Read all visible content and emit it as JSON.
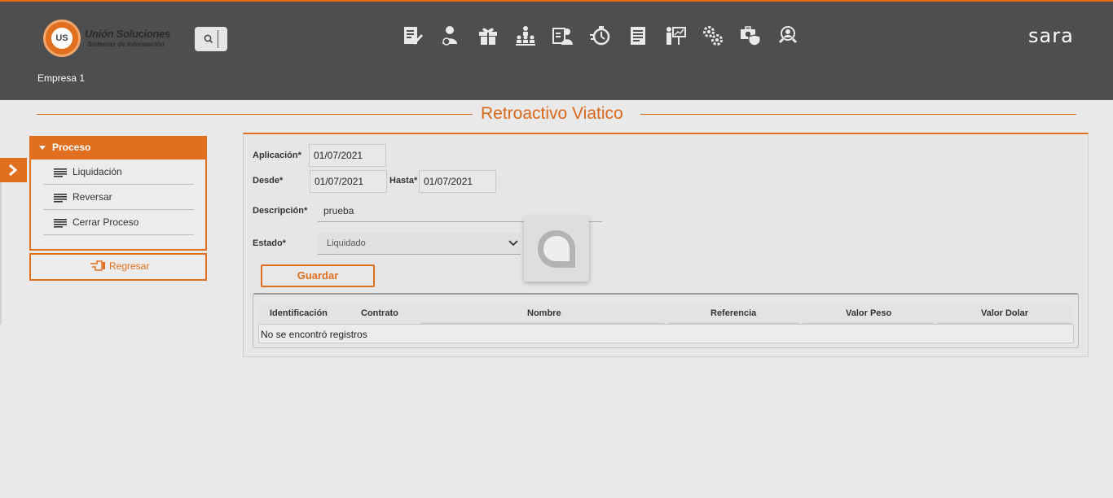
{
  "header": {
    "brand_title": "Unión Soluciones",
    "brand_subtitle": "Sistemas de Información",
    "brand_mark": "US",
    "company": "Empresa 1",
    "app_logo": "sara",
    "modules": [
      {
        "icon": "document-edit-icon"
      },
      {
        "icon": "user-money-icon"
      },
      {
        "icon": "gift-icon"
      },
      {
        "icon": "org-chart-icon"
      },
      {
        "icon": "user-id-card-icon"
      },
      {
        "icon": "stopwatch-icon"
      },
      {
        "icon": "report-list-icon"
      },
      {
        "icon": "presentation-board-icon"
      },
      {
        "icon": "gears-icon"
      },
      {
        "icon": "medical-shield-icon"
      },
      {
        "icon": "user-search-icon"
      }
    ]
  },
  "page": {
    "title": "Retroactivo Viatico"
  },
  "sidebar": {
    "section_label": "Proceso",
    "items": [
      {
        "label": "Liquidación"
      },
      {
        "label": "Reversar"
      },
      {
        "label": "Cerrar Proceso"
      }
    ],
    "back_label": "Regresar"
  },
  "form": {
    "aplicacion_label": "Aplicación*",
    "aplicacion_value": "01/07/2021",
    "desde_label": "Desde*",
    "desde_value": "01/07/2021",
    "hasta_label": "Hasta*",
    "hasta_value": "01/07/2021",
    "descripcion_label": "Descripción*",
    "descripcion_value": "prueba",
    "estado_label": "Estado*",
    "estado_value": "Liquidado",
    "save_label": "Guardar"
  },
  "grid": {
    "columns": [
      "Identificación",
      "Contrato",
      "Nombre",
      "Referencia",
      "Valor Peso",
      "Valor Dolar"
    ],
    "empty_message": "No se encontró registros"
  },
  "colors": {
    "accent": "#e0701f",
    "header_bg": "#4e4e4e",
    "page_bg": "#e9e9e9"
  }
}
